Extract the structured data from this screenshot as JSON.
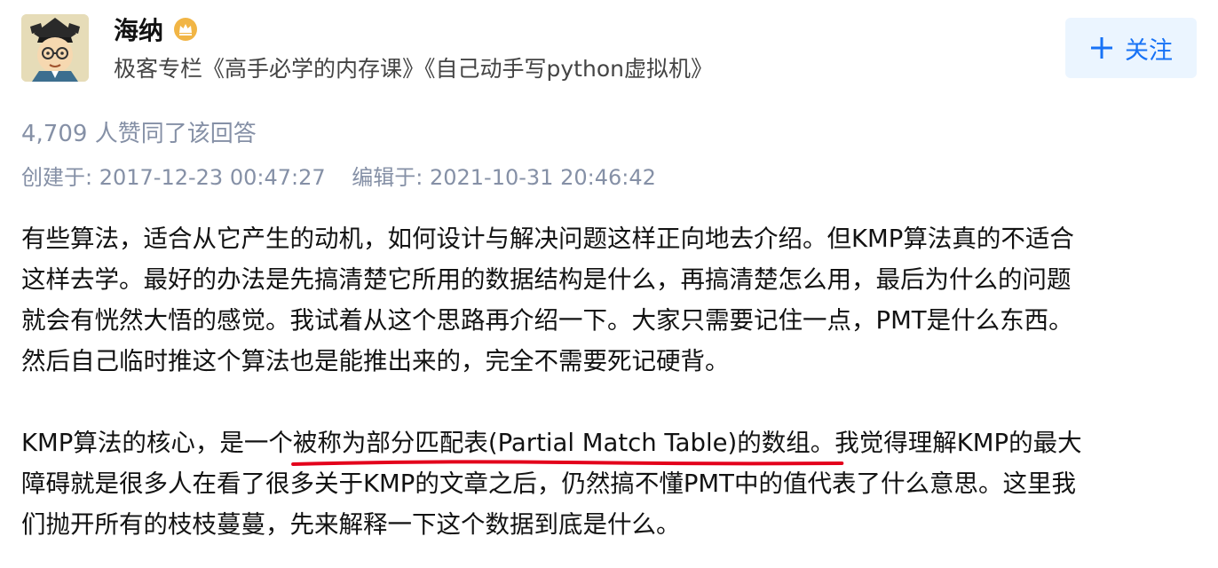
{
  "author": {
    "name": "海纳",
    "bio": "极客专栏《高手必学的内存课》《自己动手写python虚拟机》",
    "follow_label": "关注"
  },
  "answer": {
    "vote_text": "4,709 人赞同了该回答",
    "created": "创建于: 2017-12-23 00:47:27",
    "edited": "编辑于: 2021-10-31 20:46:42",
    "paragraph1": [
      "有些算法，适合从它产生的动机，如何设计与解决问题这样正向地去介绍。但KMP算法真的不适合",
      "这样去学。最好的办法是先搞清楚它所用的数据结构是什么，再搞清楚怎么用，最后为什么的问题",
      "就会有恍然大悟的感觉。我试着从这个思路再介绍一下。大家只需要记住一点，PMT是什么东西。",
      "然后自己临时推这个算法也是能推出来的，完全不需要死记硬背。"
    ],
    "paragraph2_prefix": "KMP算法的核心，是一个",
    "paragraph2_highlight": "被称为部分匹配表(Partial Match Table)的数组。",
    "paragraph2_rest": "我觉得理解KMP的最大",
    "paragraph2_lines": [
      "障碍就是很多人在看了很多关于KMP的文章之后，仍然搞不懂PMT中的值代表了什么意思。这里我",
      "们抛开所有的枝枝蔓蔓，先来解释一下这个数据到底是什么。"
    ]
  },
  "colors": {
    "accent": "#1772f6",
    "muted": "#8590a6",
    "annotation": "#e3001b",
    "badge": "#f1b545"
  }
}
